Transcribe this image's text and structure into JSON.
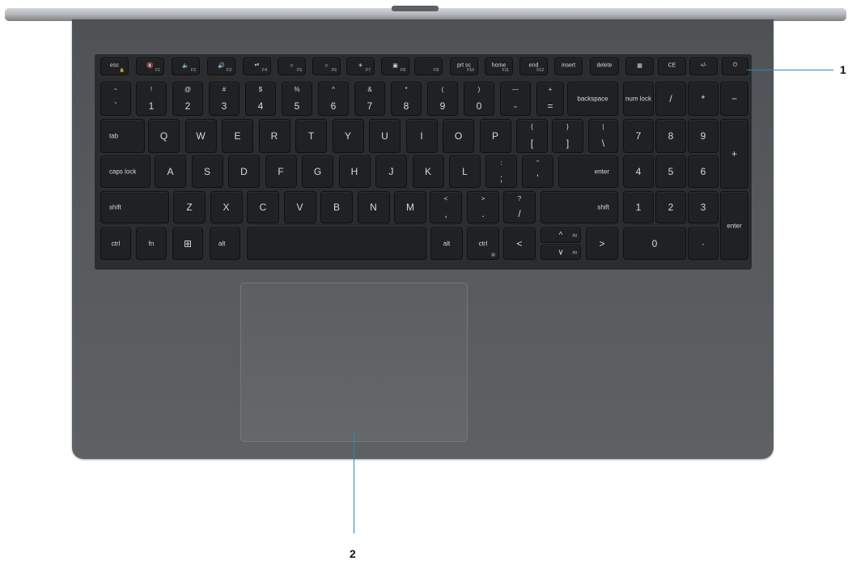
{
  "callouts": [
    {
      "number": "1",
      "target": "power-button"
    },
    {
      "number": "2",
      "target": "touchpad"
    }
  ],
  "keys": {
    "esc": "esc",
    "f1": "F1",
    "f2": "F2",
    "f3": "F3",
    "f4": "F4",
    "f5": "F5",
    "f6": "F6",
    "f7": "F7",
    "f8": "F8",
    "f9": "F9",
    "prtsc": "prt sc",
    "f10": "F10",
    "home": "home",
    "f11": "F11",
    "end": "end",
    "f12": "F12",
    "insert": "insert",
    "delete": "delete",
    "ce": "CE",
    "plusminus": "+/-",
    "row2": [
      {
        "top": "~",
        "bot": "`"
      },
      {
        "top": "!",
        "bot": "1"
      },
      {
        "top": "@",
        "bot": "2"
      },
      {
        "top": "#",
        "bot": "3"
      },
      {
        "top": "$",
        "bot": "4"
      },
      {
        "top": "%",
        "bot": "5"
      },
      {
        "top": "^",
        "bot": "6"
      },
      {
        "top": "&",
        "bot": "7"
      },
      {
        "top": "*",
        "bot": "8"
      },
      {
        "top": "(",
        "bot": "9"
      },
      {
        "top": ")",
        "bot": "0"
      },
      {
        "top": "—",
        "bot": "-"
      },
      {
        "top": "+",
        "bot": "="
      }
    ],
    "backspace": "backspace",
    "num_lock": "num lock",
    "np_div": "/",
    "np_mul": "*",
    "np_minus": "−",
    "tab": "tab",
    "row3": [
      "Q",
      "W",
      "E",
      "R",
      "T",
      "Y",
      "U",
      "I",
      "O",
      "P"
    ],
    "lbrace": {
      "top": "{",
      "bot": "["
    },
    "rbrace": {
      "top": "}",
      "bot": "]"
    },
    "pipe": {
      "top": "|",
      "bot": "\\"
    },
    "np7": "7",
    "np8": "8",
    "np9": "9",
    "np_plus": "+",
    "caps": "caps lock",
    "row4": [
      "A",
      "S",
      "D",
      "F",
      "G",
      "H",
      "J",
      "K",
      "L"
    ],
    "semicolon": {
      "top": ":",
      "bot": ";"
    },
    "quote": {
      "top": "\"",
      "bot": "'"
    },
    "enter": "enter",
    "np4": "4",
    "np5": "5",
    "np6": "6",
    "shift": "shift",
    "row5": [
      "Z",
      "X",
      "C",
      "V",
      "B",
      "N",
      "M"
    ],
    "comma": {
      "top": "<",
      "bot": ","
    },
    "period": {
      "top": ">",
      "bot": "."
    },
    "slash": {
      "top": "?",
      "bot": "/"
    },
    "np1": "1",
    "np2": "2",
    "np3": "3",
    "np_enter": "enter",
    "ctrl": "ctrl",
    "fn": "fn",
    "alt": "alt",
    "left": "<",
    "right": ">",
    "up": "^",
    "down": "∨",
    "pg": "pg",
    "np0": "0",
    "np_dot": "·"
  }
}
